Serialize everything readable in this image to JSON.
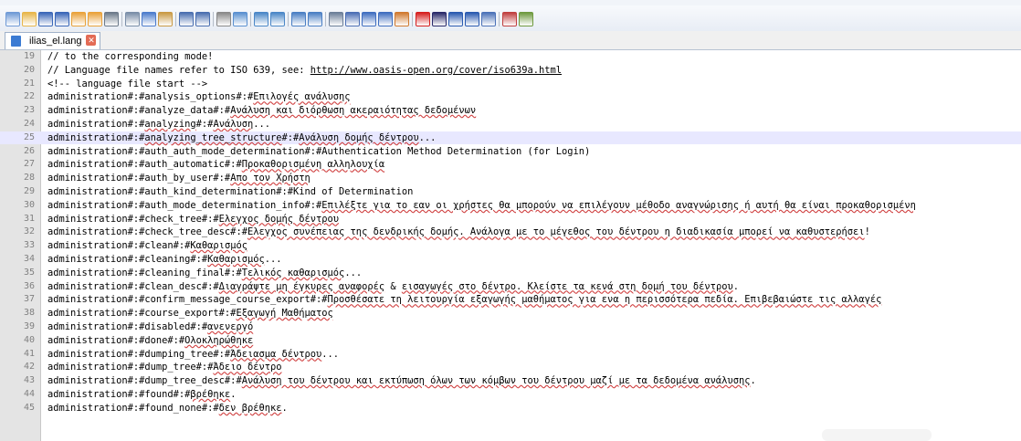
{
  "toolbar": {
    "buttons": [
      {
        "icon": "new-file-icon",
        "color": "#6f9ad6"
      },
      {
        "icon": "open-file-icon",
        "color": "#e7b64a"
      },
      {
        "icon": "save-icon",
        "color": "#3a67b8"
      },
      {
        "icon": "save-all-icon",
        "color": "#3a67b8"
      },
      {
        "icon": "close-icon",
        "color": "#e9a23b"
      },
      {
        "icon": "close-all-icon",
        "color": "#e9a23b"
      },
      {
        "icon": "print-icon",
        "color": "#6d7a8a"
      },
      {
        "sep": true
      },
      {
        "icon": "cut-icon",
        "color": "#7a8ea8"
      },
      {
        "icon": "copy-icon",
        "color": "#4d7ccc"
      },
      {
        "icon": "paste-icon",
        "color": "#c99a45"
      },
      {
        "sep": true
      },
      {
        "icon": "undo-icon",
        "color": "#4a6fb0"
      },
      {
        "icon": "redo-icon",
        "color": "#4a6fb0"
      },
      {
        "sep": true
      },
      {
        "icon": "find-icon",
        "color": "#8a8a8a"
      },
      {
        "icon": "replace-icon",
        "color": "#5a90d0"
      },
      {
        "sep": true
      },
      {
        "icon": "zoom-in-icon",
        "color": "#4b87c7"
      },
      {
        "icon": "zoom-out-icon",
        "color": "#4b87c7"
      },
      {
        "sep": true
      },
      {
        "icon": "sync-vertical-icon",
        "color": "#4b7fc4"
      },
      {
        "icon": "sync-horizontal-icon",
        "color": "#4b7fc4"
      },
      {
        "sep": true
      },
      {
        "icon": "word-wrap-icon",
        "color": "#6d7f99"
      },
      {
        "icon": "show-all-chars-icon",
        "color": "#4c6fb5"
      },
      {
        "icon": "indent-guide-icon",
        "color": "#3f6ec0"
      },
      {
        "icon": "doc-map-icon",
        "color": "#3f6ec0"
      },
      {
        "icon": "function-list-icon",
        "color": "#d07a30"
      },
      {
        "sep": true
      },
      {
        "icon": "record-macro-icon",
        "color": "#d62020"
      },
      {
        "icon": "stop-macro-icon",
        "color": "#2a2a6a"
      },
      {
        "icon": "play-macro-icon",
        "color": "#2a5ab0"
      },
      {
        "icon": "play-multiple-macro-icon",
        "color": "#2a5ab0"
      },
      {
        "icon": "save-macro-icon",
        "color": "#4c72b8"
      },
      {
        "sep": true
      },
      {
        "icon": "spell-check-icon",
        "color": "#c04040"
      },
      {
        "icon": "extra-plugin-icon",
        "color": "#6f9a40"
      }
    ]
  },
  "tab": {
    "label": "ilias_el.lang"
  },
  "editor": {
    "lines": [
      {
        "n": "19",
        "parts": [
          {
            "t": "// to the corresponding mode!"
          }
        ]
      },
      {
        "n": "20",
        "parts": [
          {
            "t": "// Language file names refer to ISO 639, see: "
          },
          {
            "t": "http://www.oasis-open.org/cover/iso639a.html",
            "link": true
          }
        ]
      },
      {
        "n": "21",
        "parts": [
          {
            "t": "<!-- language file start -->"
          }
        ]
      },
      {
        "n": "22",
        "parts": [
          {
            "t": "administration#:#analysis_options#:#"
          },
          {
            "t": "Επιλογές ανάλυσης",
            "g": true
          }
        ]
      },
      {
        "n": "23",
        "parts": [
          {
            "t": "administration#:#analyze_data#:#"
          },
          {
            "t": "Ανάλυση και διόρθωση ακεραιότητας δεδομένων",
            "g": true
          }
        ]
      },
      {
        "n": "24",
        "parts": [
          {
            "t": "administration#:#"
          },
          {
            "t": "analyzing",
            "g": true
          },
          {
            "t": "#:#"
          },
          {
            "t": "Ανάλυση",
            "g": true
          },
          {
            "t": "..."
          }
        ]
      },
      {
        "n": "25",
        "current": true,
        "parts": [
          {
            "t": "administration#:#"
          },
          {
            "t": "analyzing_tree_structure",
            "g": true
          },
          {
            "t": "#:#"
          },
          {
            "t": "Ανάλυση δομής δέντρου",
            "g": true
          },
          {
            "t": "..."
          }
        ]
      },
      {
        "n": "26",
        "parts": [
          {
            "t": "administration#:#auth_auth_mode_determination#:#Authentication Method Determination (for Login)"
          }
        ]
      },
      {
        "n": "27",
        "parts": [
          {
            "t": "administration#:#auth_automatic#:#"
          },
          {
            "t": "Προκαθορισμένη αλληλουχία",
            "g": true
          }
        ]
      },
      {
        "n": "28",
        "parts": [
          {
            "t": "administration#:#auth_by_user#:#"
          },
          {
            "t": "Απο τον Χρήστη",
            "g": true
          }
        ]
      },
      {
        "n": "29",
        "parts": [
          {
            "t": "administration#:#auth_kind_determination#:#Kind of Determination"
          }
        ]
      },
      {
        "n": "30",
        "parts": [
          {
            "t": "administration#:#auth_mode_determination_info#:#"
          },
          {
            "t": "Επιλέξτε για το εαν οι χρήστες θα μπορούν να επιλέγουν μέθοδο αναγνώρισης ή αυτή θα είναι προκαθορισμένη",
            "g": true
          }
        ]
      },
      {
        "n": "31",
        "parts": [
          {
            "t": "administration#:#check_tree#:#"
          },
          {
            "t": "Ελεγχος δομής δέντρου",
            "g": true
          }
        ]
      },
      {
        "n": "32",
        "parts": [
          {
            "t": "administration#:#check_tree_desc#:#"
          },
          {
            "t": "Ελεγχος συνέπειας της δενδρικής δομής. Ανάλογα με το μέγεθος του δέντρου η διαδικασία μπορεί να καθυστερήσει",
            "g": true
          },
          {
            "t": "!"
          }
        ]
      },
      {
        "n": "33",
        "parts": [
          {
            "t": "administration#:#clean#:#"
          },
          {
            "t": "Καθαρισμός",
            "g": true
          }
        ]
      },
      {
        "n": "34",
        "parts": [
          {
            "t": "administration#:#cleaning#:#"
          },
          {
            "t": "Καθαρισμός",
            "g": true
          },
          {
            "t": "..."
          }
        ]
      },
      {
        "n": "35",
        "parts": [
          {
            "t": "administration#:#cleaning_final#:#"
          },
          {
            "t": "Τελικός καθαρισμός",
            "g": true
          },
          {
            "t": "..."
          }
        ]
      },
      {
        "n": "36",
        "parts": [
          {
            "t": "administration#:#clean_desc#:#"
          },
          {
            "t": "Διαγράψτε μη έγκυρες αναφορές",
            "g": true
          },
          {
            "t": " & "
          },
          {
            "t": "εισαγωγές στο δέντρο. Κλείστε τα κενά στη δομή του δέντρου",
            "g": true
          },
          {
            "t": "."
          }
        ]
      },
      {
        "n": "37",
        "parts": [
          {
            "t": "administration#:#confirm_message_course_export#:#"
          },
          {
            "t": "Προσθέσατε τη λειτουργία εξαγωγής μαθήματος για ενα η περισσότερα πεδία. Επιβεβαιώστε τις αλλαγές",
            "g": true
          }
        ]
      },
      {
        "n": "38",
        "parts": [
          {
            "t": "administration#:#course_export#:#"
          },
          {
            "t": "Εξαγωγή Μαθήματος",
            "g": true
          }
        ]
      },
      {
        "n": "39",
        "parts": [
          {
            "t": "administration#:#disabled#:#"
          },
          {
            "t": "ανενεργό",
            "g": true
          }
        ]
      },
      {
        "n": "40",
        "parts": [
          {
            "t": "administration#:#done#:#"
          },
          {
            "t": "Ολοκληρώθηκε",
            "g": true
          }
        ]
      },
      {
        "n": "41",
        "parts": [
          {
            "t": "administration#:#dumping_tree#:#"
          },
          {
            "t": "Άδειασμα δέντρου",
            "g": true
          },
          {
            "t": "..."
          }
        ]
      },
      {
        "n": "42",
        "parts": [
          {
            "t": "administration#:#dump_tree#:#"
          },
          {
            "t": "Άδειο δέντρο",
            "g": true
          }
        ]
      },
      {
        "n": "43",
        "parts": [
          {
            "t": "administration#:#dump_tree_desc#:#"
          },
          {
            "t": "Ανάλυση του δέντρου και εκτύπωση όλων των κόμβων του δέντρου μαζί με τα δεδομένα ανάλυσης",
            "g": true
          },
          {
            "t": "."
          }
        ]
      },
      {
        "n": "44",
        "parts": [
          {
            "t": "administration#:#found#:#"
          },
          {
            "t": "βρέθηκε",
            "g": true
          },
          {
            "t": "."
          }
        ]
      },
      {
        "n": "45",
        "parts": [
          {
            "t": "administration#:#found_none#:#"
          },
          {
            "t": "δεν βρέθηκε",
            "g": true
          },
          {
            "t": "."
          }
        ]
      }
    ]
  }
}
